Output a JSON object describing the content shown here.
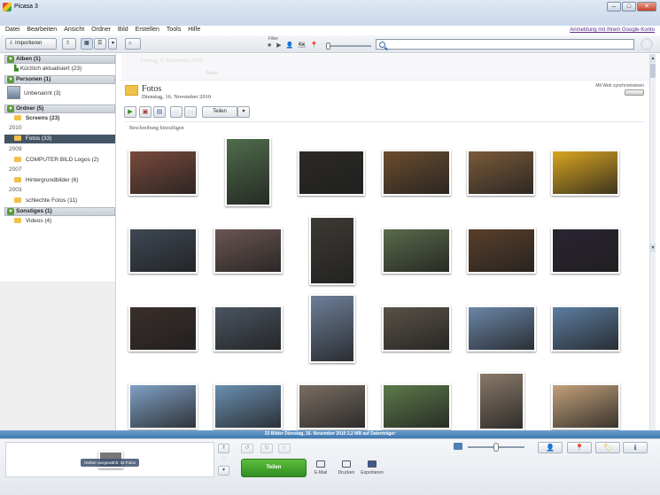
{
  "window": {
    "title": "Picasa 3",
    "minimize": "–",
    "maximize": "□",
    "close": "✕"
  },
  "menu": {
    "items": [
      "Datei",
      "Bearbeiten",
      "Ansicht",
      "Ordner",
      "Bild",
      "Erstellen",
      "Tools",
      "Hilfe"
    ],
    "account_link": "Anmeldung mit Ihrem Google-Konto"
  },
  "toolbar": {
    "import_label": "Importieren",
    "filter_label": "Filter",
    "search_value": "",
    "filter_icons": [
      "★",
      "▶",
      "👤",
      "🗺",
      "📍"
    ]
  },
  "sidebar": {
    "sections": [
      {
        "label": "Alben (1)",
        "items": [
          "Kürzlich aktualisiert (23)"
        ]
      },
      {
        "label": "Personen (1)",
        "items": [
          "Unbenannt (3)"
        ]
      },
      {
        "label": "Ordner (5)",
        "items": [
          "Screens (23)"
        ]
      }
    ],
    "years": [
      "2010",
      "2009",
      "2007",
      "2003"
    ],
    "folders": {
      "selected": "Fotos (33)",
      "f2009": "COMPUTER BILD Logos (2)",
      "f2007": "Hintergrundbilder (6)",
      "f2003": "schlechte Fotos (11)"
    },
    "other_section": "Sonstiges (1)",
    "other_item": "Videos (4)"
  },
  "album": {
    "ghost_title": "Freitag, 9. Dezember 2010",
    "ghost_share": "Teilen",
    "title": "Fotos",
    "date": "Dienstag, 16. November 2010",
    "sync_label": "Mit Web synchronisieren",
    "share_label": "Teilen",
    "add_caption": "Beschreibung hinzufügen"
  },
  "photos": [
    {
      "name": "market-food",
      "color": "#7a4a3c"
    },
    {
      "name": "japanese-castle",
      "color": "#4f6c4b"
    },
    {
      "name": "night-harbor",
      "color": "#2c2a26"
    },
    {
      "name": "tunnel-lights",
      "color": "#6b4d2f"
    },
    {
      "name": "tunnel-walkway",
      "color": "#7a5a3a"
    },
    {
      "name": "yellow-taxi",
      "color": "#d9a520"
    },
    {
      "name": "train-platform",
      "color": "#3e4854"
    },
    {
      "name": "city-street",
      "color": "#6a5652"
    },
    {
      "name": "blossom-tree",
      "color": "#3d3a34"
    },
    {
      "name": "garden-pond",
      "color": "#5a6a4a"
    },
    {
      "name": "cherry-blossom-night",
      "color": "#5a3f2a"
    },
    {
      "name": "times-square",
      "color": "#2a2432"
    },
    {
      "name": "crowd-child",
      "color": "#3a2e2a"
    },
    {
      "name": "skyline-dusk",
      "color": "#4a5460"
    },
    {
      "name": "big-ben",
      "color": "#6d7f98"
    },
    {
      "name": "subway-escalator",
      "color": "#5a5248"
    },
    {
      "name": "bridge-mosque",
      "color": "#6a86a8"
    },
    {
      "name": "blue-mosque-fountain",
      "color": "#5c7da0"
    },
    {
      "name": "mosque-minarets",
      "color": "#7fa0c4"
    },
    {
      "name": "bay-coast",
      "color": "#6a8fb0"
    },
    {
      "name": "city-rooftops",
      "color": "#7a6e64"
    },
    {
      "name": "meadow-trees",
      "color": "#5c7a4a"
    },
    {
      "name": "shaggy-dog",
      "color": "#8a7a6a"
    },
    {
      "name": "dog-sky",
      "color": "#c2a07a"
    }
  ],
  "status": {
    "text": "33 Bilder   Dienstag, 16. November 2010     2,2 MB auf Datenträger"
  },
  "bottom": {
    "tray_caption": "Ordner ausgewählt: 33 Fotos",
    "share_button": "Teilen",
    "email": "E-Mail",
    "print": "Drucken",
    "export": "Exportieren"
  },
  "colors": {
    "status_bar": "#4a83bb",
    "accent_green": "#3d9a2a",
    "selected_folder": "#445566"
  }
}
